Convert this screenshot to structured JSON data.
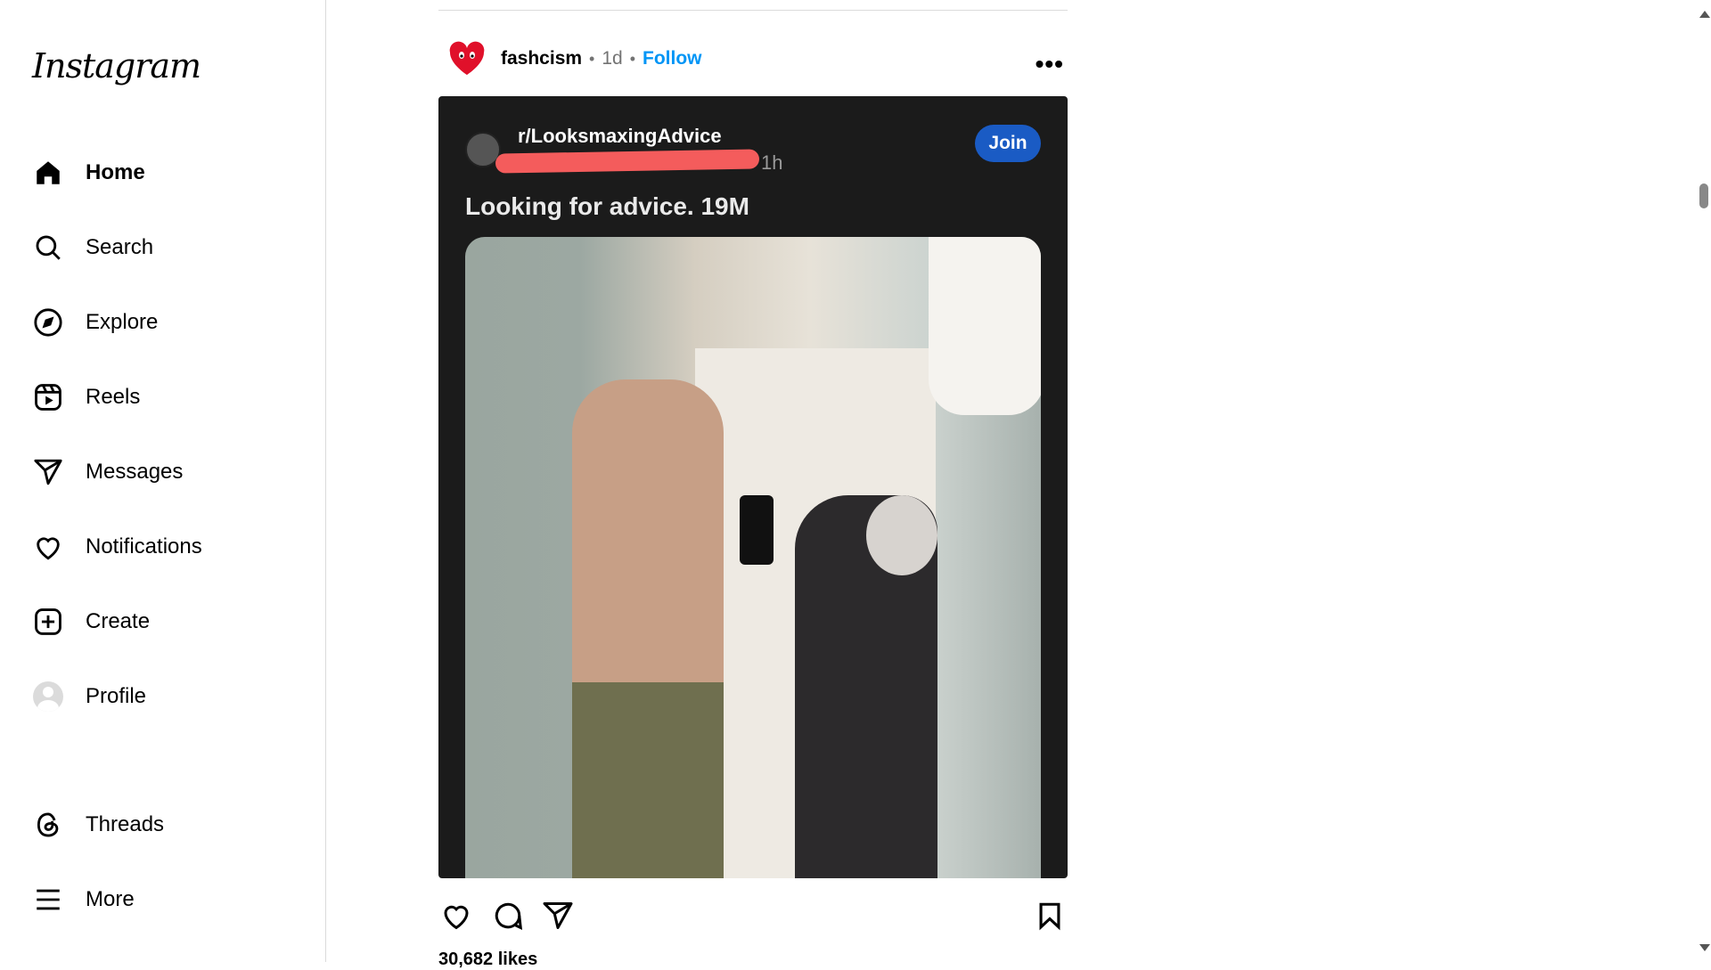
{
  "sidebar": {
    "logo": "Instagram",
    "items": [
      {
        "label": "Home",
        "icon": "home-icon"
      },
      {
        "label": "Search",
        "icon": "search-icon"
      },
      {
        "label": "Explore",
        "icon": "compass-icon"
      },
      {
        "label": "Reels",
        "icon": "reels-icon"
      },
      {
        "label": "Messages",
        "icon": "send-icon"
      },
      {
        "label": "Notifications",
        "icon": "heart-icon"
      },
      {
        "label": "Create",
        "icon": "plus-square-icon"
      },
      {
        "label": "Profile",
        "icon": "avatar-icon"
      },
      {
        "label": "Threads",
        "icon": "threads-icon"
      },
      {
        "label": "More",
        "icon": "menu-icon"
      }
    ]
  },
  "post": {
    "username": "fashcism",
    "time": "1d",
    "follow_label": "Follow",
    "more_label": "•••",
    "likes": "30,682 likes",
    "embed": {
      "subreddit": "r/LooksmaxingAdvice",
      "time": "1h",
      "join_label": "Join",
      "title": "Looking for advice. 19M"
    }
  },
  "colors": {
    "accent": "#0095f6",
    "join": "#1a5bc4",
    "redact": "#f45c5c"
  }
}
